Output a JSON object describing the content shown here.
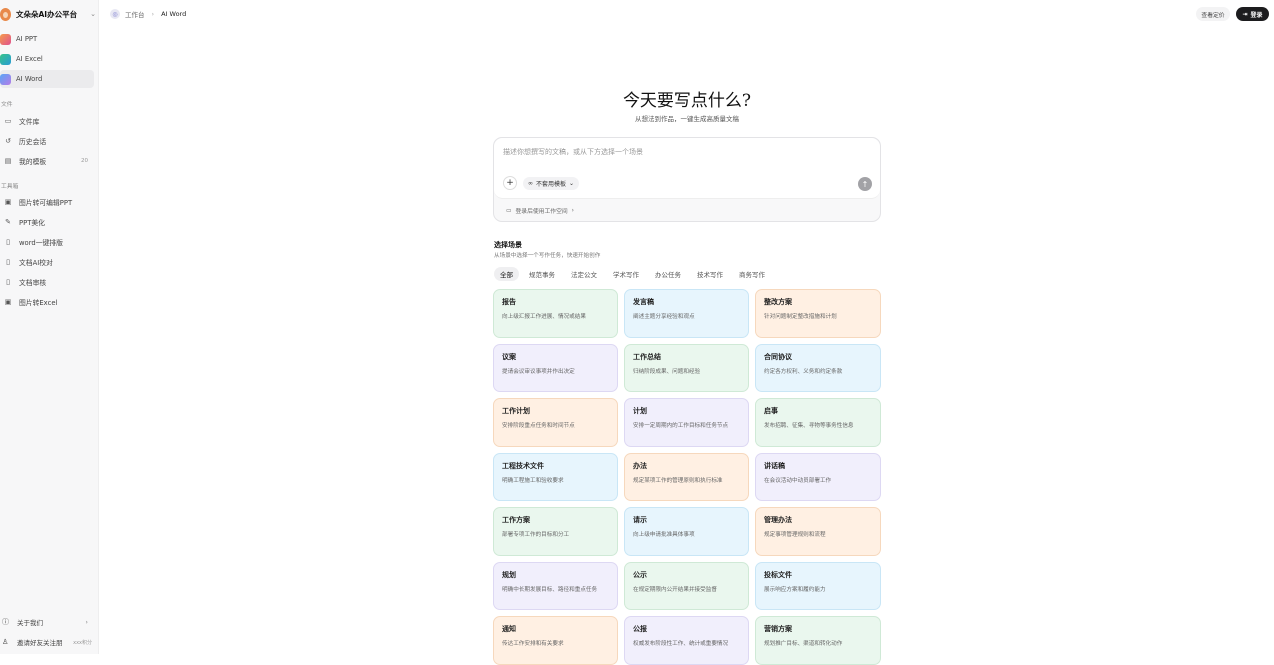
{
  "brand": {
    "name": "文朵朵AI办公平台"
  },
  "sidebar": {
    "apps": [
      {
        "label": "AI PPT",
        "color": "#ef7d4b"
      },
      {
        "label": "AI Excel",
        "color": "#33b97b"
      },
      {
        "label": "AI Word",
        "color": "#6e8df2"
      }
    ],
    "section_files": "文件",
    "files": [
      {
        "label": "文件库",
        "icon": "folder-icon"
      },
      {
        "label": "历史会话",
        "icon": "history-icon"
      },
      {
        "label": "我的模板",
        "icon": "template-icon",
        "badge": "20"
      }
    ],
    "section_tools": "工具箱",
    "tools": [
      {
        "label": "图片转可编辑PPT",
        "icon": "image-icon"
      },
      {
        "label": "PPT美化",
        "icon": "brush-icon"
      },
      {
        "label": "word一键排版",
        "icon": "doc-icon"
      },
      {
        "label": "文档AI校对",
        "icon": "doc-icon"
      },
      {
        "label": "文档审核",
        "icon": "doc-icon"
      },
      {
        "label": "图片转Excel",
        "icon": "image-icon"
      }
    ],
    "about": "关于我们",
    "invite": "邀请好友关注朋",
    "invite_badge": "xxx积分"
  },
  "breadcrumb": {
    "root": "工作台",
    "current": "AI Word"
  },
  "header": {
    "pricing": "查看定价",
    "login": "登录"
  },
  "hero": {
    "title": "今天要写点什么?",
    "subtitle": "从想法到作品，一键生成高质量文稿"
  },
  "composer": {
    "placeholder": "描述你想撰写的文稿，或从下方选择一个场景",
    "template_label": "不套用模板",
    "workspace_hint": "登录后使用工作空间"
  },
  "scenes": {
    "title": "选择场景",
    "subtitle": "从场景中选择一个写作任务，快速开始创作",
    "tabs": [
      "全部",
      "规范事务",
      "法定公文",
      "学术写作",
      "办公任务",
      "技术写作",
      "商务写作"
    ],
    "cards": [
      {
        "title": "报告",
        "desc": "向上级汇报工作进展、情况或结果",
        "color": "green"
      },
      {
        "title": "发言稿",
        "desc": "阐述主题分享经验和观点",
        "color": "blue"
      },
      {
        "title": "整改方案",
        "desc": "针对问题制定整改措施和计划",
        "color": "orange"
      },
      {
        "title": "议案",
        "desc": "提请会议审议事项并作出决定",
        "color": "purple"
      },
      {
        "title": "工作总结",
        "desc": "归纳阶段成果、问题和经验",
        "color": "green"
      },
      {
        "title": "合同协议",
        "desc": "约定各方权利、义务和约定条款",
        "color": "blue"
      },
      {
        "title": "工作计划",
        "desc": "安排阶段重点任务和时间节点",
        "color": "orange"
      },
      {
        "title": "计划",
        "desc": "安排一定周期内的工作目标和任务节点",
        "color": "purple"
      },
      {
        "title": "启事",
        "desc": "发布招聘、征集、寻物等事务性信息",
        "color": "green"
      },
      {
        "title": "工程技术文件",
        "desc": "明确工程施工和验收要求",
        "color": "blue"
      },
      {
        "title": "办法",
        "desc": "规定某项工作的管理原则和执行标准",
        "color": "orange"
      },
      {
        "title": "讲话稿",
        "desc": "在会议活动中动员部署工作",
        "color": "purple"
      },
      {
        "title": "工作方案",
        "desc": "部署专项工作的目标和分工",
        "color": "green"
      },
      {
        "title": "请示",
        "desc": "向上级申请批准具体事项",
        "color": "blue"
      },
      {
        "title": "管理办法",
        "desc": "规定事项管理规则和流程",
        "color": "orange"
      },
      {
        "title": "规划",
        "desc": "明确中长期发展目标、路径和重点任务",
        "color": "purple"
      },
      {
        "title": "公示",
        "desc": "在规定期限内公开结果并接受监督",
        "color": "green"
      },
      {
        "title": "投标文件",
        "desc": "展示响应方案和履约能力",
        "color": "blue"
      },
      {
        "title": "通知",
        "desc": "传达工作安排和有关要求",
        "color": "orange"
      },
      {
        "title": "公报",
        "desc": "权威发布阶段性工作、统计或重要情况",
        "color": "purple"
      },
      {
        "title": "营销方案",
        "desc": "规划推广目标、渠道和转化动作",
        "color": "green"
      }
    ]
  }
}
